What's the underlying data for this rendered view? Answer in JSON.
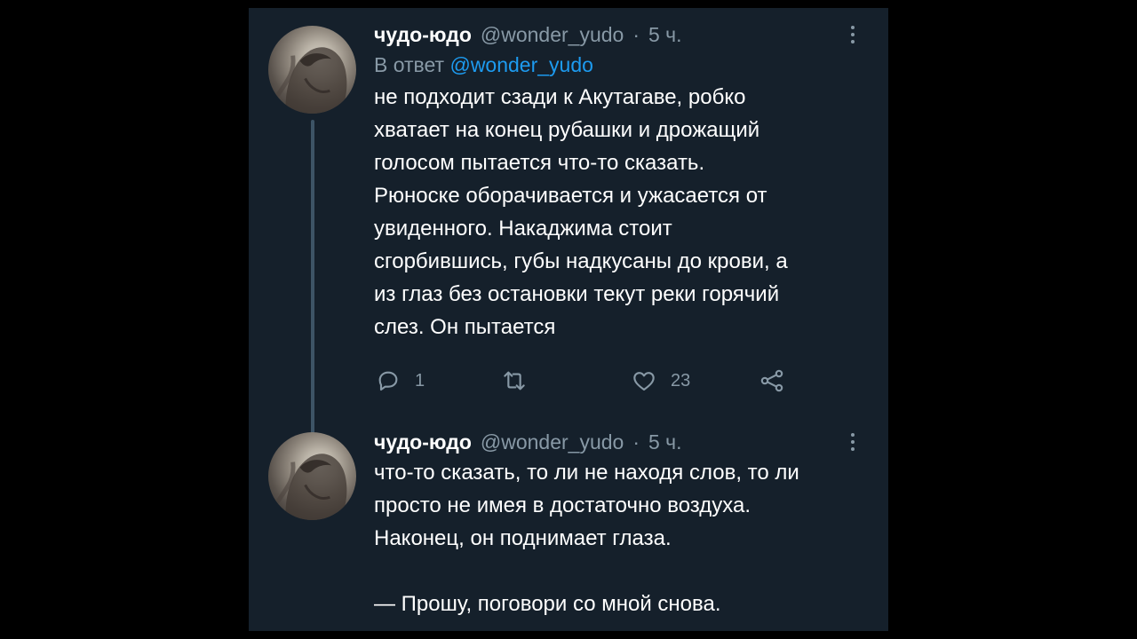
{
  "tweets": [
    {
      "name": "чудо-юдо",
      "handle": "@wonder_yudo",
      "separator": "·",
      "time": "5 ч.",
      "reply_prefix": "В ответ",
      "reply_handle": "@wonder_yudo",
      "text": "не подходит сзади к Акутагаве, робко\nхватает на конец рубашки и дрожащий\nголосом пытается что-то сказать.\nРюноске оборачивается и ужасается от\nувиденного. Накаджима стоит\nсгорбившись, губы надкусаны до крови, а\nиз глаз без остановки текут реки горячий\nслез. Он пытается",
      "actions": {
        "reply": {
          "icon": "reply-icon",
          "count": "1"
        },
        "retweet": {
          "icon": "retweet-icon",
          "count": ""
        },
        "like": {
          "icon": "heart-icon",
          "count": "23"
        },
        "share": {
          "icon": "share-icon"
        }
      }
    },
    {
      "name": "чудо-юдо",
      "handle": "@wonder_yudo",
      "separator": "·",
      "time": "5 ч.",
      "text": "что-то сказать,  то ли не находя слов, то ли\nпросто не имея в достаточно воздуха.\nНаконец, он поднимает глаза.\n\n— Прошу, поговори со мной снова."
    }
  ],
  "colors": {
    "background": "#15202b",
    "text": "#ffffff",
    "secondary": "#8899a6",
    "link": "#1d9bf0"
  }
}
